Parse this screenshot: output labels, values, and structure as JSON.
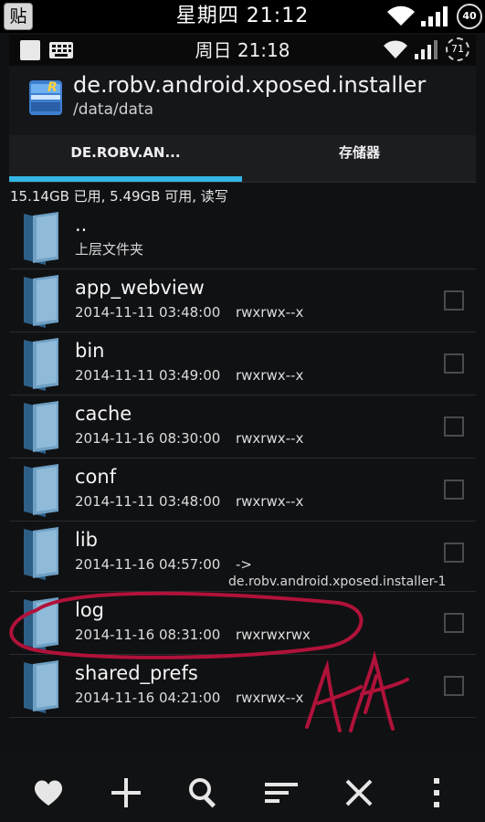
{
  "outer_status": {
    "paste_icon_label": "贴",
    "clock": "星期四 21:12",
    "battery": "40"
  },
  "app_status": {
    "clock": "周日 21:18",
    "battery": "71"
  },
  "header": {
    "title": "de.robv.android.xposed.installer",
    "path": "/data/data"
  },
  "tabs": [
    {
      "label": "DE.ROBV.AN...",
      "selected": true
    },
    {
      "label": "存储器",
      "selected": false
    }
  ],
  "storage_info": "15.14GB 已用, 5.49GB 可用, 读写",
  "files": [
    {
      "name": "..",
      "subtitle": "上层文件夹"
    },
    {
      "name": "app_webview",
      "date": "2014-11-11 03:48:00",
      "perm": "rwxrwx--x"
    },
    {
      "name": "bin",
      "date": "2014-11-11 03:49:00",
      "perm": "rwxrwx--x"
    },
    {
      "name": "cache",
      "date": "2014-11-16 08:30:00",
      "perm": "rwxrwx--x"
    },
    {
      "name": "conf",
      "date": "2014-11-11 03:48:00",
      "perm": "rwxrwx--x"
    },
    {
      "name": "lib",
      "date": "2014-11-16 04:57:00",
      "perm": "->",
      "link": "de.robv.android.xposed.installer-1"
    },
    {
      "name": "log",
      "date": "2014-11-16 08:31:00",
      "perm": "rwxrwxrwx"
    },
    {
      "name": "shared_prefs",
      "date": "2014-11-16 04:21:00",
      "perm": "rwxrwx--x"
    }
  ],
  "bottom_bar": {
    "icons": [
      "heart-icon",
      "plus-icon",
      "search-icon",
      "sort-icon",
      "close-icon",
      "more-vert-icon"
    ]
  },
  "colors": {
    "accent": "#33b5e5",
    "annotation": "#b0123a"
  }
}
